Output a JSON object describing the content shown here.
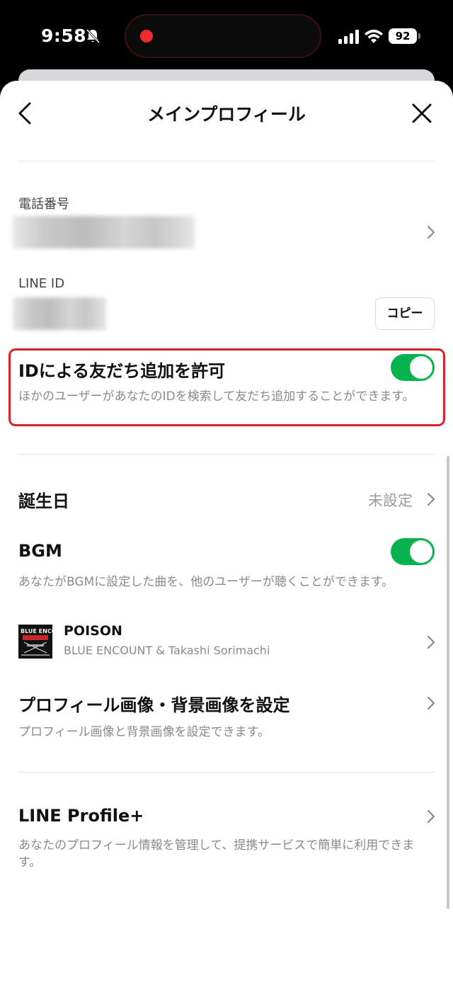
{
  "status": {
    "time": "9:58",
    "battery": "92"
  },
  "header": {
    "title": "メインプロフィール"
  },
  "phone": {
    "label": "電話番号"
  },
  "line_id": {
    "label": "LINE ID",
    "copy_label": "コピー"
  },
  "allow_id": {
    "title": "IDによる友だち追加を許可",
    "description": "ほかのユーザーがあなたのIDを検索して友だち追加することができます。",
    "enabled": true
  },
  "birthday": {
    "label": "誕生日",
    "value": "未設定"
  },
  "bgm": {
    "title": "BGM",
    "description": "あなたがBGMに設定した曲を、他のユーザーが聴くことができます。",
    "enabled": true,
    "song_title": "POISON",
    "song_artist": "BLUE ENCOUNT & Takashi Sorimachi",
    "album_text": "BLUE ENCOUNT"
  },
  "profile_image": {
    "title": "プロフィール画像・背景画像を設定",
    "description": "プロフィール画像と背景画像を設定できます。"
  },
  "profile_plus": {
    "title": "LINE Profile+",
    "description": "あなたのプロフィール情報を管理して、提携サービスで簡単に利用できます。"
  },
  "colors": {
    "accent_green": "#06b24e",
    "highlight_red": "#d8232a"
  }
}
